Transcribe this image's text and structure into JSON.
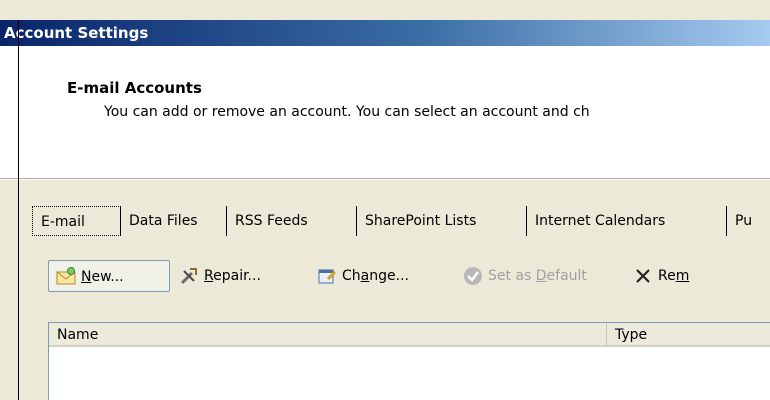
{
  "window": {
    "title": "Account Settings"
  },
  "header": {
    "title": "E-mail Accounts",
    "description": "You can add or remove an account. You can select an account and ch"
  },
  "tabs": [
    {
      "label": "E-mail",
      "active": true
    },
    {
      "label": "Data Files"
    },
    {
      "label": "RSS Feeds"
    },
    {
      "label": "SharePoint Lists"
    },
    {
      "label": "Internet Calendars"
    },
    {
      "label": "Pu"
    }
  ],
  "toolbar": {
    "new_label_u": "N",
    "new_label_rest": "ew...",
    "repair_label_u": "R",
    "repair_label_rest": "epair...",
    "change_label_pre": "Ch",
    "change_label_u": "a",
    "change_label_rest": "nge...",
    "default_label_pre": "Set as ",
    "default_label_u": "D",
    "default_label_rest": "efault",
    "remove_label_pre": "Re",
    "remove_label_u": "m"
  },
  "list": {
    "columns": [
      "Name",
      "Type"
    ]
  },
  "colors": {
    "title_gradient_start": "#0a246a",
    "title_gradient_end": "#a6caf0",
    "disabled_text": "#a0a0a0"
  },
  "icons": [
    "new-mail-icon",
    "repair-tools-icon",
    "change-account-icon",
    "set-default-check-icon",
    "remove-x-icon"
  ]
}
